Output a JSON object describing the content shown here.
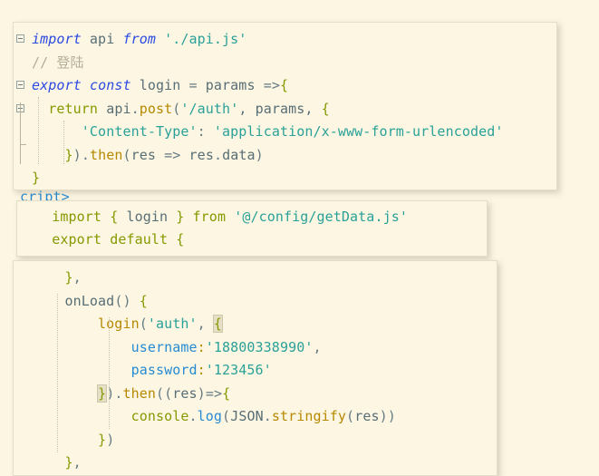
{
  "theme": {
    "background": "#fdf6e3",
    "panel_background": "#fdf6e3",
    "panel_border": "#e4ddc7",
    "text": "#586e75",
    "keyword": "#2b4ae2",
    "string": "#2aa198",
    "function": "#b58900",
    "property": "#268bd2",
    "declaration": "#859900",
    "comment": "#b5ad96",
    "match_highlight": "#e6dfc6"
  },
  "background_text": {
    "fragment": "cript>"
  },
  "panels": {
    "api_module": {
      "lines": [
        {
          "fold": "open",
          "tokens": [
            {
              "t": "import",
              "c": "kw"
            },
            {
              "t": " api ",
              "c": "plain"
            },
            {
              "t": "from",
              "c": "kw"
            },
            {
              "t": " ",
              "c": "plain"
            },
            {
              "t": "'./api.js'",
              "c": "str"
            }
          ]
        },
        {
          "fold": "none",
          "tokens": [
            {
              "t": "// 登陆",
              "c": "comment"
            }
          ]
        },
        {
          "fold": "open",
          "tokens": [
            {
              "t": "export",
              "c": "kw"
            },
            {
              "t": " ",
              "c": "plain"
            },
            {
              "t": "const",
              "c": "kw"
            },
            {
              "t": " login ",
              "c": "plain"
            },
            {
              "t": "=",
              "c": "op"
            },
            {
              "t": " params ",
              "c": "plain"
            },
            {
              "t": "=>",
              "c": "op"
            },
            {
              "t": "{",
              "c": "brace"
            }
          ]
        },
        {
          "fold": "open",
          "tokens": [
            {
              "t": "  ",
              "c": "plain"
            },
            {
              "t": "return",
              "c": "def"
            },
            {
              "t": " api",
              "c": "plain"
            },
            {
              "t": ".",
              "c": "punc"
            },
            {
              "t": "post",
              "c": "fn"
            },
            {
              "t": "(",
              "c": "punc"
            },
            {
              "t": "'/auth'",
              "c": "str"
            },
            {
              "t": ", params, ",
              "c": "plain"
            },
            {
              "t": "{",
              "c": "brace"
            }
          ]
        },
        {
          "fold": "none",
          "tokens": [
            {
              "t": "      ",
              "c": "plain"
            },
            {
              "t": "'Content-Type'",
              "c": "str"
            },
            {
              "t": ": ",
              "c": "punc"
            },
            {
              "t": "'application/x-www-form-urlencoded'",
              "c": "str"
            }
          ]
        },
        {
          "fold": "end",
          "tokens": [
            {
              "t": "    ",
              "c": "plain"
            },
            {
              "t": "}",
              "c": "brace"
            },
            {
              "t": ")",
              "c": "punc"
            },
            {
              "t": ".",
              "c": "punc"
            },
            {
              "t": "then",
              "c": "fn"
            },
            {
              "t": "(",
              "c": "punc"
            },
            {
              "t": "res ",
              "c": "plain"
            },
            {
              "t": "=>",
              "c": "op"
            },
            {
              "t": " res",
              "c": "plain"
            },
            {
              "t": ".",
              "c": "punc"
            },
            {
              "t": "data",
              "c": "plain"
            },
            {
              "t": ")",
              "c": "punc"
            }
          ]
        },
        {
          "fold": "none",
          "tokens": [
            {
              "t": "}",
              "c": "brace"
            }
          ]
        }
      ]
    },
    "vue_header": {
      "lines": [
        {
          "fold": "none",
          "tokens": [
            {
              "t": "  ",
              "c": "plain"
            },
            {
              "t": "import",
              "c": "def"
            },
            {
              "t": " ",
              "c": "plain"
            },
            {
              "t": "{",
              "c": "brace"
            },
            {
              "t": " login ",
              "c": "plain"
            },
            {
              "t": "}",
              "c": "brace"
            },
            {
              "t": " ",
              "c": "plain"
            },
            {
              "t": "from",
              "c": "def"
            },
            {
              "t": " ",
              "c": "plain"
            },
            {
              "t": "'@/config/getData.js'",
              "c": "str"
            }
          ]
        },
        {
          "fold": "none",
          "tokens": [
            {
              "t": "  ",
              "c": "plain"
            },
            {
              "t": "export",
              "c": "def"
            },
            {
              "t": " ",
              "c": "plain"
            },
            {
              "t": "default",
              "c": "def"
            },
            {
              "t": " ",
              "c": "plain"
            },
            {
              "t": "{",
              "c": "brace"
            }
          ]
        }
      ]
    },
    "onload_method": {
      "lines": [
        {
          "fold": "none",
          "tokens": [
            {
              "t": "    ",
              "c": "plain"
            },
            {
              "t": "}",
              "c": "brace"
            },
            {
              "t": ",",
              "c": "punc"
            }
          ]
        },
        {
          "fold": "none",
          "tokens": [
            {
              "t": "    onLoad",
              "c": "plain"
            },
            {
              "t": "() ",
              "c": "punc"
            },
            {
              "t": "{",
              "c": "brace"
            }
          ]
        },
        {
          "fold": "none",
          "tokens": [
            {
              "t": "        ",
              "c": "plain"
            },
            {
              "t": "login",
              "c": "fn"
            },
            {
              "t": "(",
              "c": "punc"
            },
            {
              "t": "'auth'",
              "c": "str"
            },
            {
              "t": ", ",
              "c": "punc"
            },
            {
              "t": "{",
              "c": "brace matched"
            }
          ]
        },
        {
          "fold": "none",
          "tokens": [
            {
              "t": "            ",
              "c": "plain"
            },
            {
              "t": "username",
              "c": "prop"
            },
            {
              "t": ":",
              "c": "fn"
            },
            {
              "t": "'18800338990'",
              "c": "str"
            },
            {
              "t": ",",
              "c": "punc"
            }
          ]
        },
        {
          "fold": "none",
          "tokens": [
            {
              "t": "            ",
              "c": "plain"
            },
            {
              "t": "password",
              "c": "prop"
            },
            {
              "t": ":",
              "c": "fn"
            },
            {
              "t": "'123456'",
              "c": "str"
            }
          ]
        },
        {
          "fold": "none",
          "tokens": [
            {
              "t": "        ",
              "c": "plain"
            },
            {
              "t": "}",
              "c": "brace matched"
            },
            {
              "t": ")",
              "c": "punc"
            },
            {
              "t": ".",
              "c": "punc"
            },
            {
              "t": "then",
              "c": "fn"
            },
            {
              "t": "((",
              "c": "punc"
            },
            {
              "t": "res",
              "c": "plain"
            },
            {
              "t": ")",
              "c": "punc"
            },
            {
              "t": "=>",
              "c": "op"
            },
            {
              "t": "{",
              "c": "brace"
            }
          ]
        },
        {
          "fold": "none",
          "tokens": [
            {
              "t": "            ",
              "c": "plain"
            },
            {
              "t": "console",
              "c": "def"
            },
            {
              "t": ".",
              "c": "punc"
            },
            {
              "t": "log",
              "c": "prop"
            },
            {
              "t": "(",
              "c": "punc"
            },
            {
              "t": "JSON",
              "c": "plain"
            },
            {
              "t": ".",
              "c": "punc"
            },
            {
              "t": "stringify",
              "c": "fn"
            },
            {
              "t": "(",
              "c": "punc"
            },
            {
              "t": "res",
              "c": "plain"
            },
            {
              "t": "))",
              "c": "punc"
            }
          ]
        },
        {
          "fold": "none",
          "tokens": [
            {
              "t": "        ",
              "c": "plain"
            },
            {
              "t": "}",
              "c": "brace"
            },
            {
              "t": ")",
              "c": "punc"
            }
          ]
        },
        {
          "fold": "none",
          "tokens": [
            {
              "t": "    ",
              "c": "plain"
            },
            {
              "t": "}",
              "c": "brace"
            },
            {
              "t": ",",
              "c": "punc"
            }
          ]
        }
      ]
    }
  }
}
